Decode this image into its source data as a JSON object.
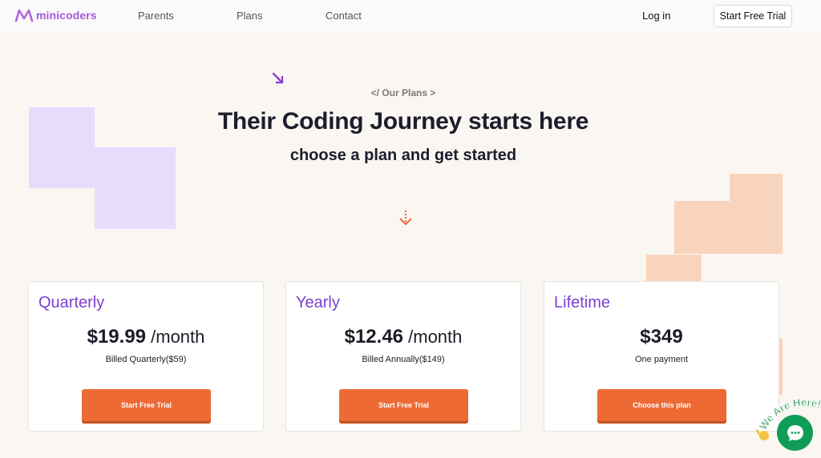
{
  "nav": {
    "brand": "minicoders",
    "links": [
      "Parents",
      "Plans",
      "Contact"
    ],
    "login": "Log in",
    "cta": "Start Free Trial"
  },
  "hero": {
    "eyebrow": "</ Our Plans >",
    "title": "Their Coding Journey starts here",
    "subtitle": "choose a plan and get started"
  },
  "plans": [
    {
      "name": "Quarterly",
      "price": "$19.99",
      "period": " /month",
      "billing": "Billed Quarterly($59)",
      "button": "Start Free Trial"
    },
    {
      "name": "Yearly",
      "price": "$12.46",
      "period": " /month",
      "billing": "Billed Annually($149)",
      "button": "Start Free Trial"
    },
    {
      "name": "Lifetime",
      "price": "$349",
      "period": "",
      "billing": "One payment",
      "button": "Choose this plan"
    }
  ],
  "chat": {
    "label": "We Are Here!"
  },
  "colors": {
    "brand": "#a35ad6",
    "plan_name": "#7b3fd1",
    "button": "#ee6a35",
    "chat": "#0f9d58"
  },
  "icons": [
    "minicoders-logo-icon",
    "arrow-diagonal-icon",
    "arrow-down-icon",
    "chat-icon",
    "waving-hand-icon"
  ]
}
